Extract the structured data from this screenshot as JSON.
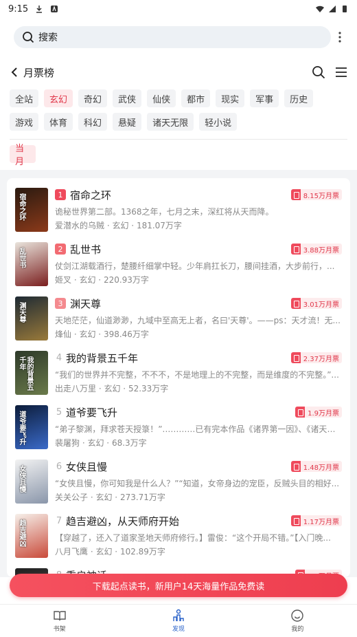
{
  "status": {
    "time": "9:15"
  },
  "search": {
    "placeholder": "搜索"
  },
  "header": {
    "title": "月票榜"
  },
  "categories": [
    "全站",
    "玄幻",
    "奇幻",
    "武侠",
    "仙侠",
    "都市",
    "现实",
    "军事",
    "历史",
    "游戏",
    "体育",
    "科幻",
    "悬疑",
    "诸天无限",
    "轻小说"
  ],
  "active_category": "玄幻",
  "period": "当月",
  "books": [
    {
      "rank": "1",
      "title": "宿命之环",
      "desc": "诡秘世界第二部。1368之年，七月之末，深红将从天而降。",
      "author": "爱潜水的乌贼",
      "genre": "玄幻",
      "words": "181.07万字",
      "tickets": "8.15万月票",
      "cover_text": "宿命之环",
      "colors": [
        "#2a1a10",
        "#8c3a1a"
      ]
    },
    {
      "rank": "2",
      "title": "乱世书",
      "desc": "仗剑江湖载酒行，楚腰纤细掌中轻。少年肩扛长刀，腰间挂酒，大步前行，...",
      "author": "姬叉",
      "genre": "玄幻",
      "words": "220.93万字",
      "tickets": "3.88万月票",
      "cover_text": "乱世书",
      "colors": [
        "#e9e4dc",
        "#7a1e1e"
      ]
    },
    {
      "rank": "3",
      "title": "渊天尊",
      "desc": "天地茫茫，仙道渺渺，九域中至高无上者，名曰'天尊'。——ps：天才流！无...",
      "author": "烽仙",
      "genre": "玄幻",
      "words": "398.46万字",
      "tickets": "3.01万月票",
      "cover_text": "渊天尊",
      "colors": [
        "#1e2a34",
        "#9a7a3a"
      ]
    },
    {
      "rank": "4",
      "title": "我的背景五千年",
      "desc": "“我们的世界并不完整，不不不，不是地理上的不完整，而是维度的不完整。”...",
      "author": "出走八万里",
      "genre": "玄幻",
      "words": "52.33万字",
      "tickets": "2.37万月票",
      "cover_text": "我的背景五千年",
      "colors": [
        "#2e3a2a",
        "#6a7a4a"
      ]
    },
    {
      "rank": "5",
      "title": "道爷要飞升",
      "desc": "“弟子黎渊，拜求苍天授箓！”…………已有完本作品《诸界第一因》、《诸天投...",
      "author": "裴屠狗",
      "genre": "玄幻",
      "words": "68.3万字",
      "tickets": "1.9万月票",
      "cover_text": "道爷要飞升",
      "colors": [
        "#0c1c3a",
        "#3a6ac9"
      ]
    },
    {
      "rank": "6",
      "title": "女侠且慢",
      "desc": "“女侠且慢，你可知我是什么人？”“知道，女帝身边的宠臣，反贼头目的相好...",
      "author": "关关公子",
      "genre": "玄幻",
      "words": "273.71万字",
      "tickets": "1.48万月票",
      "cover_text": "女侠且慢",
      "colors": [
        "#f2f2f2",
        "#8a96aa"
      ]
    },
    {
      "rank": "7",
      "title": "趋吉避凶，从天师府开始",
      "desc": "【穿越了，还入了道家圣地天师府修行。】雷俊：“这个开局不错。”【入门晚...",
      "author": "八月飞鹰",
      "genre": "玄幻",
      "words": "102.89万字",
      "tickets": "1.17万月票",
      "cover_text": "趋吉避凶",
      "colors": [
        "#f6f0ea",
        "#c94a3a"
      ]
    },
    {
      "rank": "8",
      "title": "重启神话",
      "desc": "",
      "author": "",
      "genre": "",
      "words": "",
      "tickets": "1.1万月票",
      "cover_text": "",
      "colors": [
        "#222",
        "#444"
      ]
    }
  ],
  "banner": "下载起点读书，新用户14天海量作品免费读",
  "tabs": [
    {
      "label": "书架",
      "icon": "book-icon"
    },
    {
      "label": "发现",
      "icon": "discover-icon"
    },
    {
      "label": "我的",
      "icon": "profile-icon"
    }
  ]
}
